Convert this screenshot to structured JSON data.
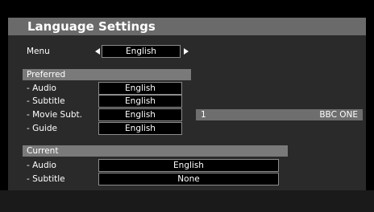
{
  "title": "Language Settings",
  "menu": {
    "label": "Menu",
    "value": "English"
  },
  "preferred": {
    "header": "Preferred",
    "rows": [
      {
        "label": "- Audio",
        "value": "English"
      },
      {
        "label": "- Subtitle",
        "value": "English"
      },
      {
        "label": "- Movie Subt.",
        "value": "English"
      },
      {
        "label": "- Guide",
        "value": "English"
      }
    ]
  },
  "channel": {
    "number": "1",
    "name": "BBC ONE"
  },
  "current": {
    "header": "Current",
    "rows": [
      {
        "label": "- Audio",
        "value": "English"
      },
      {
        "label": "- Subtitle",
        "value": "None"
      }
    ]
  },
  "icons": {
    "left_arrow": "left-arrow-icon",
    "right_arrow": "right-arrow-icon"
  },
  "colors": {
    "title_bar": "#6a6a6a",
    "section_header": "#7a7a7a",
    "panel_bg": "#2a2a2a",
    "value_border": "#8c8c8c",
    "channel_bar": "#6e6e6e"
  }
}
